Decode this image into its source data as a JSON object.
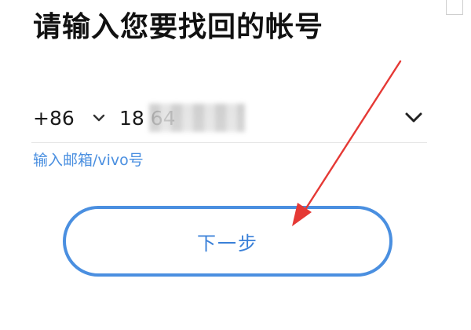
{
  "header": {
    "title": "请输入您要找回的帐号"
  },
  "phone_input": {
    "country_code": "+86",
    "value": "18            64"
  },
  "links": {
    "email_vivo": "输入邮箱/vivo号"
  },
  "actions": {
    "next_label": "下一步"
  },
  "annotation": {
    "color": "#e53935"
  },
  "theme": {
    "accent": "#4a8fe0"
  }
}
